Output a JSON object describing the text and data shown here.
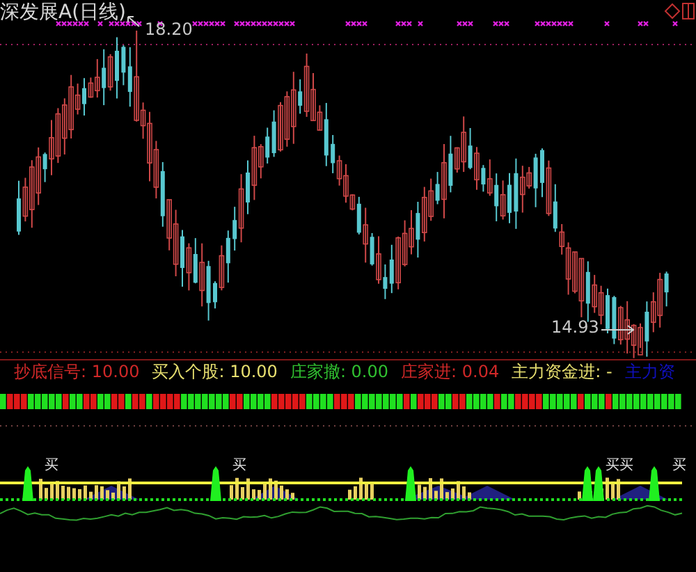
{
  "chart": {
    "title": "深发展A(日线)",
    "high_label": "18.20",
    "low_label": "14.93"
  },
  "indicators": [
    {
      "label": "抄底信号: 10.00",
      "color": "#d02828"
    },
    {
      "label": "买入个股: 10.00",
      "color": "#e8e070"
    },
    {
      "label": "庄家撤: 0.00",
      "color": "#30c030"
    },
    {
      "label": "庄家进: 0.04",
      "color": "#d02828"
    },
    {
      "label": "主力资金进: -",
      "color": "#e8e070"
    },
    {
      "label": "主力资",
      "color": "#1010c0"
    }
  ],
  "signals": [
    {
      "label": "买"
    },
    {
      "label": "买"
    },
    {
      "label": "买买"
    },
    {
      "label": "买"
    }
  ]
}
